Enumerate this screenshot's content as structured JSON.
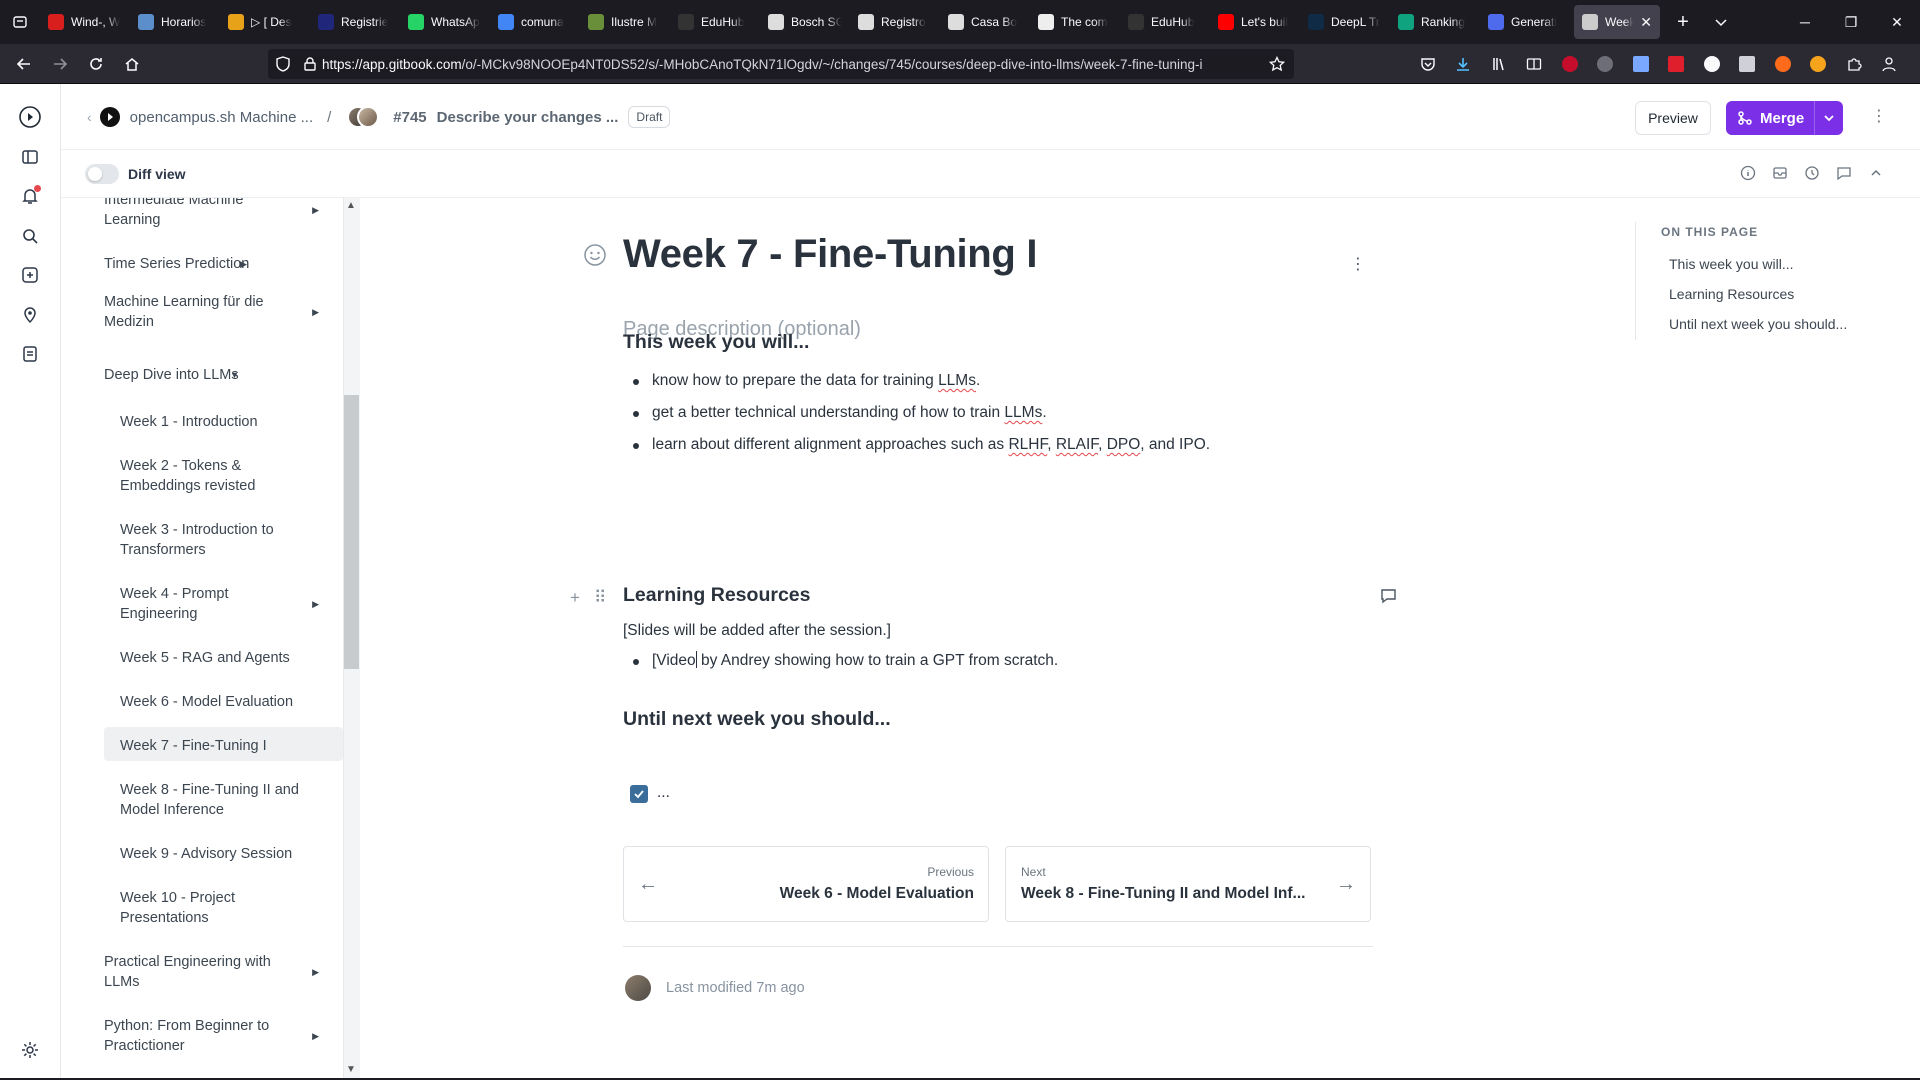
{
  "browser": {
    "tabs": [
      {
        "label": "Wind-, W",
        "color": "#d91e1e"
      },
      {
        "label": "Horarios",
        "color": "#5b8ecb"
      },
      {
        "label": "▷ [ Des",
        "color": "#e8a21a"
      },
      {
        "label": "Registrie",
        "color": "#20277a"
      },
      {
        "label": "WhatsAp",
        "color": "#25d366"
      },
      {
        "label": "comuna",
        "color": "#4285f4"
      },
      {
        "label": "Ilustre M",
        "color": "#6a8f3a"
      },
      {
        "label": "EduHub",
        "color": "#333333"
      },
      {
        "label": "Bosch SG",
        "color": "#dddddd"
      },
      {
        "label": "Registro",
        "color": "#dddddd"
      },
      {
        "label": "Casa Bo",
        "color": "#dddddd"
      },
      {
        "label": "The com",
        "color": "#eeeeee"
      },
      {
        "label": "EduHub",
        "color": "#333333"
      },
      {
        "label": "Let's buil",
        "color": "#ff0000"
      },
      {
        "label": "DeepL Tr",
        "color": "#0f2b46"
      },
      {
        "label": "Ranking",
        "color": "#10a37f"
      },
      {
        "label": "Generati",
        "color": "#4f6bed"
      }
    ],
    "active_tab": {
      "label": "Week",
      "color": "#cccccc"
    },
    "url_host": "https://app.gitbook.com",
    "url_path": "/o/-MCkv98NOOEp4NT0DS52/s/-MHobCAnoTQkN71lOgdv/~/changes/745/courses/deep-dive-into-llms/week-7-fine-tuning-i"
  },
  "header": {
    "space_name": "opencampus.sh Machine ...",
    "separator": "/",
    "change_number": "#745",
    "change_title": "Describe your changes ...",
    "status_badge": "Draft",
    "preview_label": "Preview",
    "merge_label": "Merge"
  },
  "subheader": {
    "diff_view_label": "Diff view"
  },
  "sidebar": {
    "items": [
      {
        "label": "Intermediate Machine Learning",
        "has_children": true
      },
      {
        "label": "Time Series Prediction",
        "has_children": true
      },
      {
        "label": "Machine Learning für die Medizin",
        "has_children": true
      },
      {
        "label": "Deep Dive into LLMs",
        "expanded": true
      },
      {
        "label": "Week 1 - Introduction"
      },
      {
        "label": "Week 2 - Tokens & Embeddings revisted"
      },
      {
        "label": "Week 3 - Introduction to Transformers"
      },
      {
        "label": "Week 4 - Prompt Engineering",
        "has_children": true
      },
      {
        "label": "Week 5 - RAG and Agents"
      },
      {
        "label": "Week 6 - Model Evaluation"
      },
      {
        "label": "Week 7 - Fine-Tuning I",
        "active": true
      },
      {
        "label": "Week 8 - Fine-Tuning II and Model Inference"
      },
      {
        "label": "Week 9 - Advisory Session"
      },
      {
        "label": "Week 10 - Project Presentations"
      },
      {
        "label": "Practical Engineering with LLMs",
        "has_children": true
      },
      {
        "label": "Python: From Beginner to Practictioner",
        "has_children": true
      }
    ]
  },
  "page": {
    "title": "Week 7 - Fine-Tuning I",
    "description_placeholder": "Page description (optional)",
    "section1": {
      "heading": "This week you will...",
      "bullets": [
        {
          "pre": "know how to prepare the data for training ",
          "flag": "LLMs",
          "post": "."
        },
        {
          "pre": "get a better technical understanding of how to train ",
          "flag": "LLMs",
          "post": "."
        },
        {
          "pre": "learn about different alignment approaches such as ",
          "flags": [
            "RLHF",
            "RLAIF",
            "DPO"
          ],
          "post": ", and IPO."
        }
      ]
    },
    "section2": {
      "heading": "Learning Resources",
      "paragraph": "[Slides will be added after the session.]",
      "bullet_a": "[Video",
      "bullet_b": " by Andrey showing how to train a GPT from scratch."
    },
    "section3": {
      "heading": "Until next week you should...",
      "checkbox_text": "..."
    },
    "previous": {
      "label": "Previous",
      "title": "Week 6 - Model Evaluation"
    },
    "next": {
      "label": "Next",
      "title": "Week 8 - Fine-Tuning II and Model Inf..."
    },
    "last_modified": "Last modified 7m ago"
  },
  "on_this_page": {
    "title": "ON THIS PAGE",
    "links": [
      "This week you will...",
      "Learning Resources",
      "Until next week you should..."
    ]
  }
}
